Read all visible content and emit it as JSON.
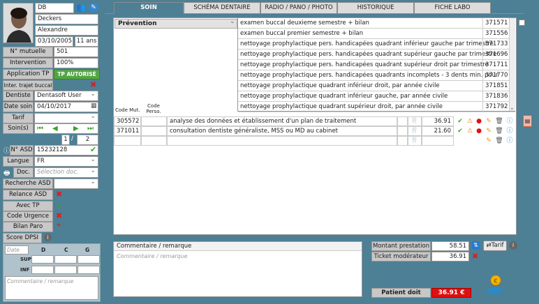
{
  "patient": {
    "id": "DB",
    "last_name": "Deckers",
    "first_name": "Alexandre",
    "birthdate": "03/10/2005",
    "age": "11 ans"
  },
  "fields": {
    "mutuelle_label": "N° mutuelle",
    "mutuelle_value": "501",
    "intervention_label": "Intervention",
    "intervention_value": "100%",
    "application_tp_label": "Application TP",
    "application_tp_value": "TP AUTORISÉ",
    "inter_trajet_label": "Inter. trajet buccal",
    "dentiste_label": "Dentiste",
    "dentiste_value": "Dentasoft User",
    "date_soin_label": "Date soin",
    "date_soin_value": "04/10/2017",
    "tarif_label": "Tarif",
    "soins_label": "Soin(s)",
    "soin_index": "1",
    "soin_total": "2",
    "soin_sep": "/",
    "asd_label": "N° ASD",
    "asd_value": "15232128",
    "langue_label": "Langue",
    "langue_value": "FR",
    "doc_label": "Doc.",
    "doc_placeholder": "Sélection doc.",
    "recherche_asd_label": "Recherche ASD",
    "relance_asd_label": "Relance ASD",
    "avec_tp_label": "Avec TP",
    "code_urgence_label": "Code Urgence",
    "bilan_paro_label": "Bilan Paro",
    "score_dpsi_label": "Score DPSI",
    "dpsi_date_placeholder": "Date",
    "dpsi_cols": [
      "D",
      "C",
      "G"
    ],
    "dpsi_rows": [
      "SUP",
      "INF"
    ],
    "left_comment_placeholder": "Commentaire / remarque"
  },
  "tabs": [
    {
      "label": "SOIN",
      "active": true
    },
    {
      "label": "SCHÉMA DENTAIRE",
      "active": false
    },
    {
      "label": "RADIO / PANO / PHOTO",
      "active": false
    },
    {
      "label": "HISTORIQUE",
      "active": false
    },
    {
      "label": "FICHE LABO",
      "active": false
    }
  ],
  "category_select": "Prévention",
  "dropdown_items": [
    {
      "desc": "examen buccal deuxieme semestre + bilan",
      "code": "371571"
    },
    {
      "desc": "examen buccal premier semestre + bilan",
      "code": "371556"
    },
    {
      "desc": "nettoyage prophylactique pers. handicapées quadrant inférieur gauche par trimestre",
      "code": "371733"
    },
    {
      "desc": "nettoyage prophylactique pers. handicapées quadrant supérieur gauche par trimestre",
      "code": "371696"
    },
    {
      "desc": "nettoyage prophylactique pers. handicapées quadrant supérieur droit par trimestre",
      "code": "371711"
    },
    {
      "desc": "nettoyage prophylactique pers. handicapées quadrants incomplets - 3 dents min. pour",
      "code": "371770"
    },
    {
      "desc": "nettoyage prophylactique quadrant inférieur droit, par année civile",
      "code": "371851"
    },
    {
      "desc": "nettoyage prophylactique quadrant inférieur gauche, par année civile",
      "code": "371836"
    },
    {
      "desc": "nettoyage prophylactique quadrant supérieur droit, par année civile",
      "code": "371792"
    }
  ],
  "table_headers": {
    "code_mut": "Code Mut.",
    "code_perso": "Code Perso."
  },
  "rows": [
    {
      "code_mut": "305572",
      "code_perso": "",
      "desc": "analyse des données et établissement d'un plan de traitement",
      "amount": "36.91"
    },
    {
      "code_mut": "371011",
      "code_perso": "",
      "desc": "consultation dentiste généraliste, MSS ou MD au cabinet",
      "amount": "21.60"
    },
    {
      "code_mut": "",
      "code_perso": "",
      "desc": "",
      "amount": ""
    }
  ],
  "comment": {
    "title": "Commentaire / remarque",
    "placeholder": "Commentaire / remarque"
  },
  "summary": {
    "montant_label": "Montant prestation",
    "montant_value": "58.51",
    "ticket_label": "Ticket modérateur",
    "ticket_value": "36.91",
    "tarif_button": "Tarif",
    "patient_doit_label": "Patient doit",
    "patient_doit_value": "36.91 €"
  },
  "colors": {
    "background": "#4d7f95",
    "accent_green": "#53a545",
    "danger_red": "#e01010"
  }
}
